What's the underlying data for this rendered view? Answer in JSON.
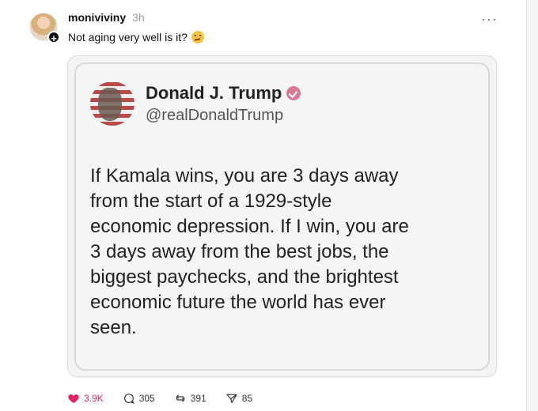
{
  "post": {
    "username": "moniviviny",
    "time": "3h",
    "caption": "Not aging very well is it?",
    "caption_emoji": "thinking-face-emoji"
  },
  "embedded_tweet": {
    "name": "Donald J. Trump",
    "handle": "@realDonaldTrump",
    "text_lines": [
      "If Kamala wins, you are 3 days away",
      "from the start of a 1929-style",
      "economic depression. If I win, you are",
      "3 days away from the best jobs, the",
      "biggest paychecks, and the brightest",
      "economic future the world has ever",
      "seen."
    ]
  },
  "actions": {
    "likes": "3.9K",
    "replies": "305",
    "reposts": "391",
    "shares": "85"
  },
  "icons": {
    "like": "heart-icon",
    "reply": "comment-icon",
    "repost": "repost-icon",
    "share": "send-icon",
    "more": "more-options-icon",
    "follow": "plus-icon",
    "verified": "verified-badge-icon"
  },
  "colors": {
    "like_active": "#e0245e",
    "text": "#111111",
    "muted": "#999999",
    "verified_badge": "#d87a95"
  }
}
